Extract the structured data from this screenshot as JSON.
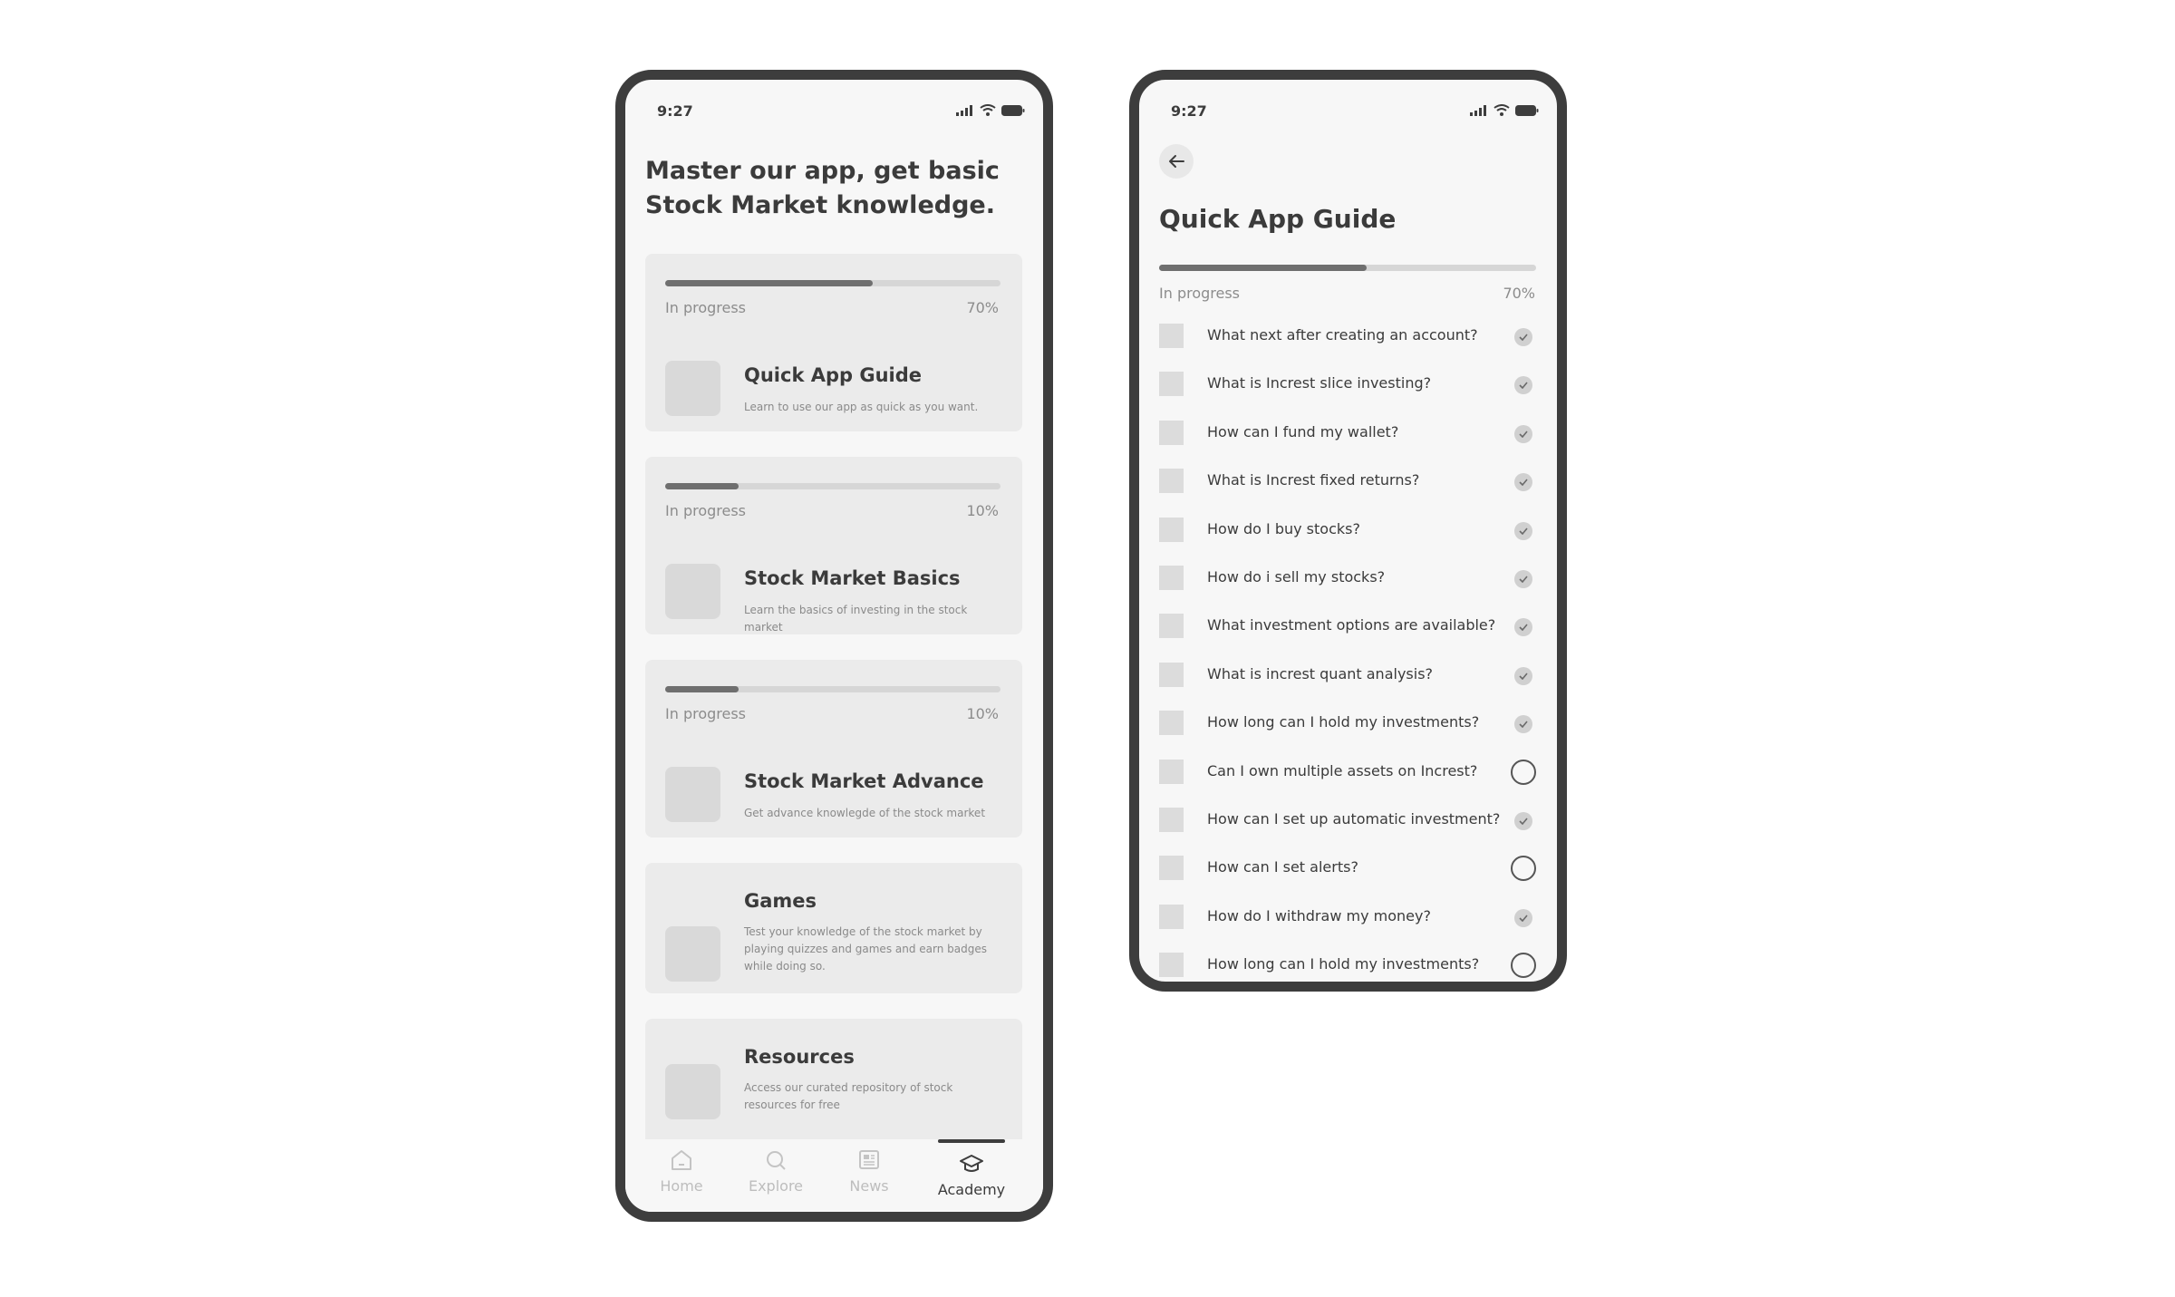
{
  "left": {
    "status_time": "9:27",
    "page_title_line1": "Master our app, get basic",
    "page_title_line2": "Stock Market knowledge.",
    "courses": [
      {
        "progress_label": "In progress",
        "progress_percent": "70%",
        "progress": 0.62,
        "title": "Quick App Guide",
        "desc": "Learn to use our app as quick as you want."
      },
      {
        "progress_label": "In progress",
        "progress_percent": "10%",
        "progress": 0.22,
        "title": "Stock Market Basics",
        "desc": "Learn the basics of investing in the stock market"
      },
      {
        "progress_label": "In progress",
        "progress_percent": "10%",
        "progress": 0.22,
        "title": "Stock Market Advance",
        "desc": "Get advance knowlegde of the stock market"
      }
    ],
    "extras": [
      {
        "title": "Games",
        "desc": "Test your knowledge of the stock market by playing quizzes and games and earn badges while doing so."
      },
      {
        "title": "Resources",
        "desc": "Access our curated repository of stock resources for free"
      }
    ],
    "tabs": [
      {
        "label": "Home",
        "icon": "home-icon"
      },
      {
        "label": "Explore",
        "icon": "search-icon"
      },
      {
        "label": "News",
        "icon": "news-icon"
      },
      {
        "label": "Academy",
        "icon": "graduation-cap-icon",
        "active": true
      }
    ]
  },
  "right": {
    "status_time": "9:27",
    "back_icon": "arrow-left-icon",
    "page_title": "Quick App Guide",
    "progress_label": "In progress",
    "progress_percent": "70%",
    "progress": 0.55,
    "questions": [
      {
        "text": "What next after creating an account?",
        "done": true
      },
      {
        "text": "What is Increst slice investing?",
        "done": true
      },
      {
        "text": "How can I fund my wallet?",
        "done": true
      },
      {
        "text": "What is Increst fixed returns?",
        "done": true
      },
      {
        "text": "How do I buy stocks?",
        "done": true
      },
      {
        "text": "How do i sell my stocks?",
        "done": true
      },
      {
        "text": "What investment options are available?",
        "done": true
      },
      {
        "text": "What is increst quant analysis?",
        "done": true
      },
      {
        "text": "How long can I hold my investments?",
        "done": true
      },
      {
        "text": "Can I own multiple assets on Increst?",
        "done": false
      },
      {
        "text": "How can I set up automatic investment?",
        "done": true
      },
      {
        "text": "How can I set alerts?",
        "done": false
      },
      {
        "text": "How do I withdraw my money?",
        "done": true
      },
      {
        "text": "How long can I hold my investments?",
        "done": false
      }
    ]
  }
}
